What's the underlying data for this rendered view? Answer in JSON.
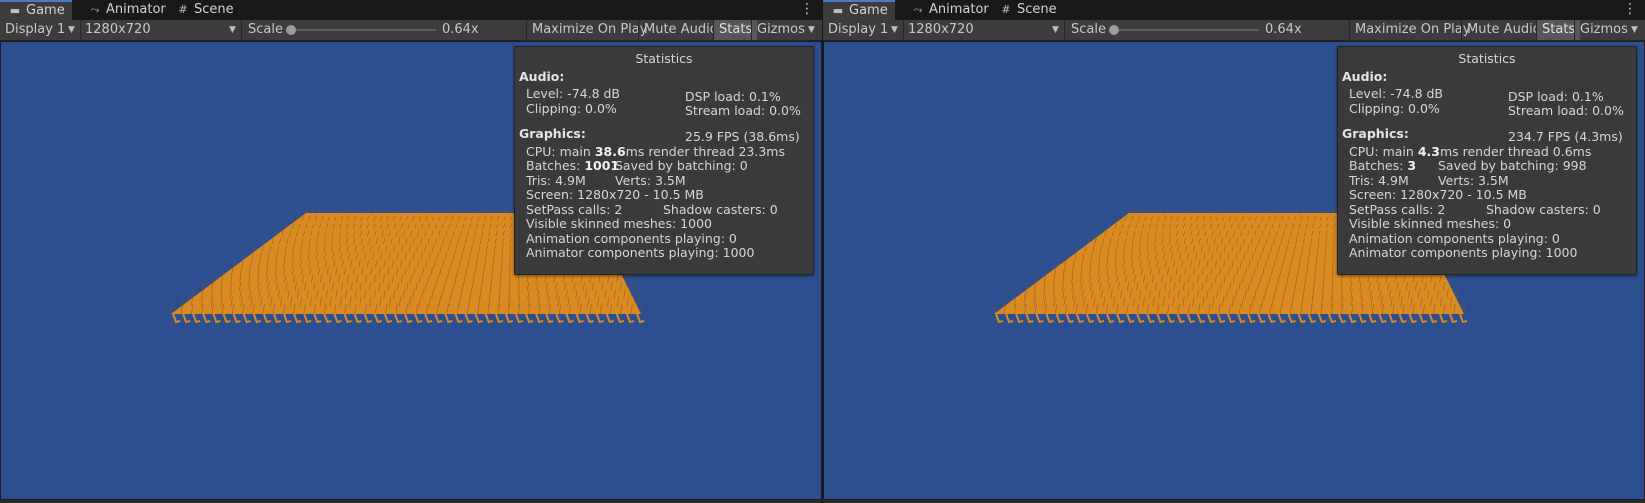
{
  "tabs": [
    {
      "label": "Game",
      "icon": "gamepad-icon",
      "active": true
    },
    {
      "label": "Animator",
      "icon": "animator-icon",
      "active": false
    },
    {
      "label": "Scene",
      "icon": "grid-icon",
      "active": false
    }
  ],
  "toolbar": {
    "display": "Display 1",
    "resolution": "1280x720",
    "scale_label": "Scale",
    "scale_value": "0.64x",
    "maximize_on_play": "Maximize On Play",
    "mute_audio": "Mute Audio",
    "stats": "Stats",
    "gizmos": "Gizmos"
  },
  "colors": {
    "viewport_background": "#2d4f8f",
    "characters": "#d98a22",
    "stats_panel": "#3a3a3a"
  },
  "panels": [
    {
      "title": "Statistics",
      "audio_heading": "Audio:",
      "level": "Level: -74.8 dB",
      "clipping": "Clipping: 0.0%",
      "dsp_load": "DSP load: 0.1%",
      "stream_load": "Stream load: 0.0%",
      "graphics_heading": "Graphics:",
      "fps": "25.9 FPS (38.6ms)",
      "cpu_prefix": "CPU: main ",
      "cpu_main": "38.6",
      "cpu_suffix": "ms  render thread 23.3ms",
      "batches_prefix": "Batches: ",
      "batches": "1001",
      "saved_by_batching": "Saved by batching: 0",
      "tris": "Tris: 4.9M",
      "verts": "Verts: 3.5M",
      "screen": "Screen: 1280x720 - 10.5 MB",
      "setpass": "SetPass calls: 2",
      "shadow_casters": "Shadow casters: 0",
      "skinned": "Visible skinned meshes: 1000",
      "animation": "Animation components playing: 0",
      "animator": "Animator components playing: 1000"
    },
    {
      "title": "Statistics",
      "audio_heading": "Audio:",
      "level": "Level: -74.8 dB",
      "clipping": "Clipping: 0.0%",
      "dsp_load": "DSP load: 0.1%",
      "stream_load": "Stream load: 0.0%",
      "graphics_heading": "Graphics:",
      "fps": "234.7 FPS (4.3ms)",
      "cpu_prefix": "CPU: main ",
      "cpu_main": "4.3",
      "cpu_suffix": "ms  render thread 0.6ms",
      "batches_prefix": "Batches: ",
      "batches": "3",
      "saved_by_batching": "Saved by batching: 998",
      "tris": "Tris: 4.9M",
      "verts": "Verts: 3.5M",
      "screen": "Screen: 1280x720 - 10.5 MB",
      "setpass": "SetPass calls: 2",
      "shadow_casters": "Shadow casters: 0",
      "skinned": "Visible skinned meshes: 0",
      "animation": "Animation components playing: 0",
      "animator": "Animator components playing: 1000"
    }
  ]
}
